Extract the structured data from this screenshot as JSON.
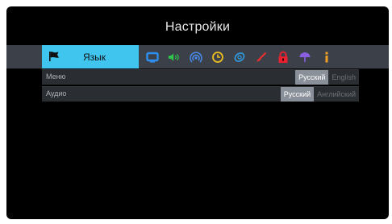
{
  "title": "Настройки",
  "tabs": {
    "active_label": "Язык",
    "icons": [
      {
        "name": "monitor-icon",
        "color": "#2f8ff0"
      },
      {
        "name": "speaker-icon",
        "color": "#2ec84a"
      },
      {
        "name": "broadcast-icon",
        "color": "#4a8cf0"
      },
      {
        "name": "clock-icon",
        "color": "#f0c020"
      },
      {
        "name": "globe-icon",
        "color": "#2f9be0"
      },
      {
        "name": "brush-icon",
        "color": "#e83030"
      },
      {
        "name": "lock-icon",
        "color": "#e82030"
      },
      {
        "name": "umbrella-icon",
        "color": "#8a5ee0"
      },
      {
        "name": "info-icon",
        "color": "#f0a020"
      }
    ]
  },
  "settings": [
    {
      "label": "Меню",
      "options": [
        "Русский",
        "English"
      ],
      "selected": 0
    },
    {
      "label": "Аудио",
      "options": [
        "Русский",
        "Английский"
      ],
      "selected": 0
    }
  ],
  "colors": {
    "accent": "#3fc5ee",
    "tabbar": "#3c4149",
    "row": "#2a2d32",
    "selected_option": "#8a9099"
  }
}
